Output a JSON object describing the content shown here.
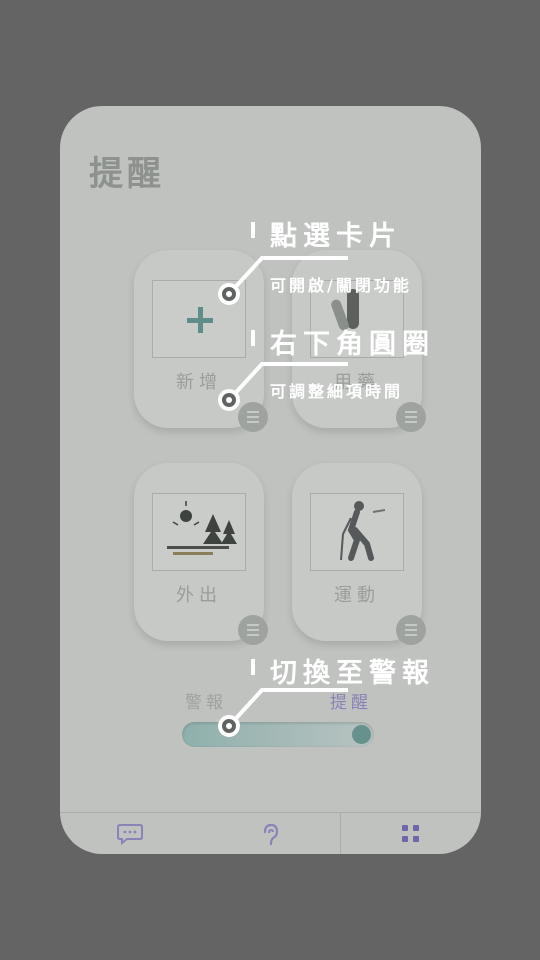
{
  "screen": {
    "title": "提醒",
    "cards": [
      {
        "label": "新增",
        "icon": "plus-icon"
      },
      {
        "label": "用藥",
        "icon": "pill-icon"
      },
      {
        "label": "外出",
        "icon": "outdoor-trees-icon"
      },
      {
        "label": "運動",
        "icon": "hiking-person-icon"
      }
    ],
    "mode_switch": {
      "left_label": "警報",
      "right_label": "提醒"
    },
    "tabs": [
      {
        "icon": "chat-bubble-icon"
      },
      {
        "icon": "hearing-ear-icon"
      },
      {
        "icon": "grid-apps-icon"
      }
    ]
  },
  "tips": [
    {
      "title": "點選卡片",
      "subtitle": "可開啟/關閉功能"
    },
    {
      "title": "右下角圓圈",
      "subtitle": "可調整細項時間"
    },
    {
      "title": "切換至警報",
      "subtitle": ""
    }
  ],
  "colors": {
    "overlay_bg": "#646464",
    "accent_teal": "#5f8d89",
    "accent_purple": "#8a83b8",
    "tip_text": "#ffffff"
  }
}
